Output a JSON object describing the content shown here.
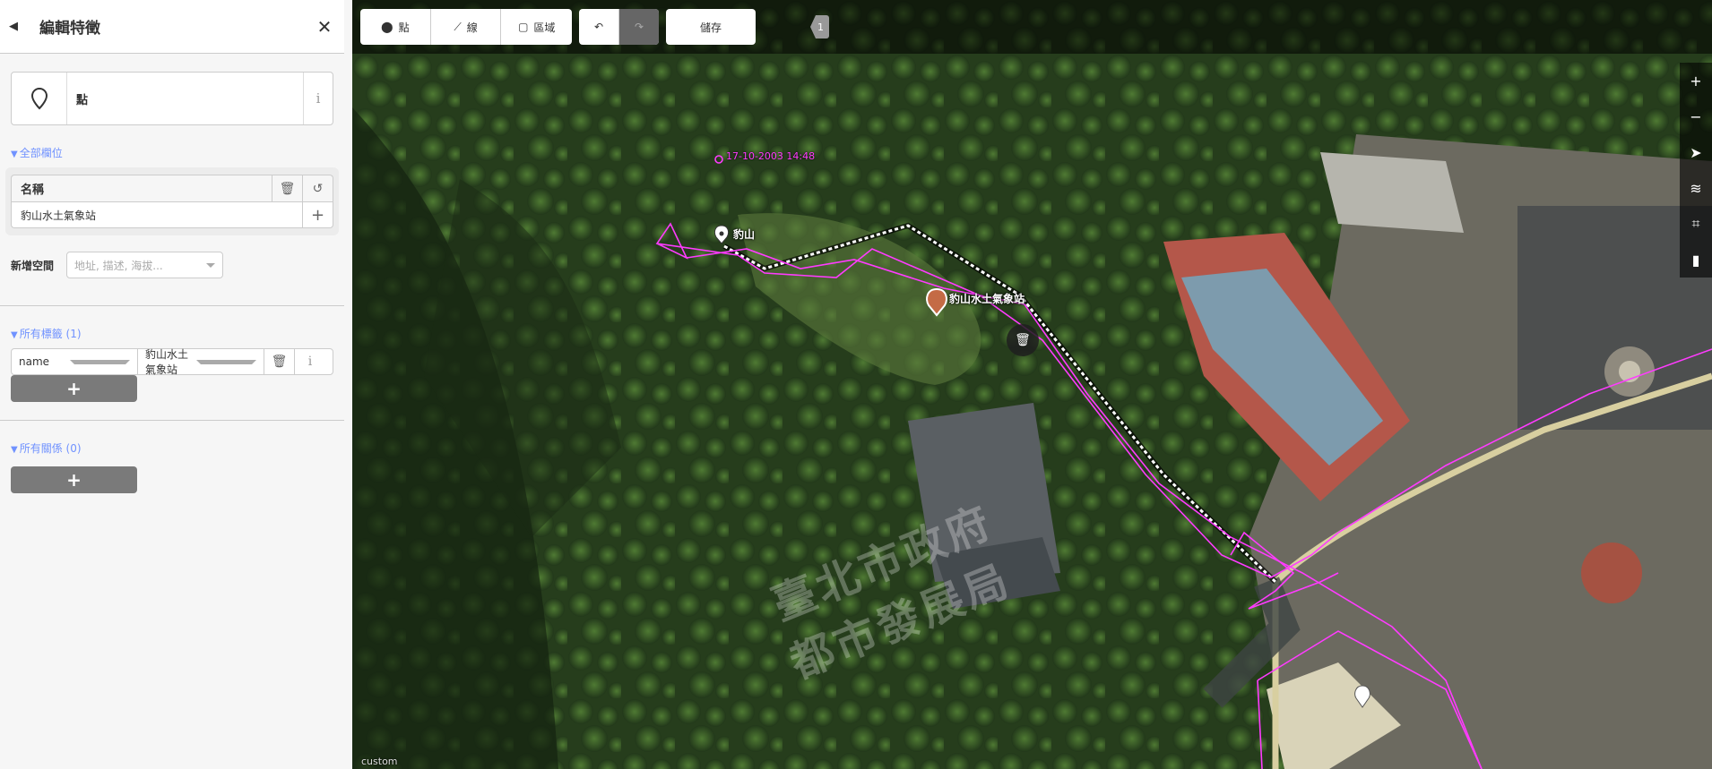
{
  "sidebar": {
    "back_icon": "back-arrow-icon",
    "title": "編輯特徵",
    "close_icon": "close-icon",
    "preset": {
      "icon": "map-pin-icon",
      "label": "點",
      "info_icon": "info-icon"
    },
    "all_fields_toggle": "全部欄位",
    "name_field": {
      "label": "名稱",
      "value": "豹山水土氣象站"
    },
    "add_field": {
      "label": "新增空間",
      "placeholder": "地址, 描述, 海拔..."
    },
    "all_tags_toggle": "所有標籤 (1)",
    "tags": [
      {
        "key": "name",
        "value": "豹山水土氣象站"
      }
    ],
    "all_relations_toggle": "所有關係 (0)"
  },
  "toolbar": {
    "point_label": "點",
    "line_label": "線",
    "area_label": "區域",
    "save_label": "儲存",
    "edit_count": "1"
  },
  "map": {
    "gpx_timestamp": "17-10-2003 14:48",
    "peak_label": "豹山",
    "station_label": "豹山水土氣象站",
    "watermark_line1": "臺北市政府",
    "watermark_line2": "都市發展局",
    "imagery_source": "custom",
    "colors": {
      "gpx": "#ff3bff",
      "path": "#ffffff",
      "road": "#d8cfa0",
      "accent": "#7092ff"
    }
  }
}
